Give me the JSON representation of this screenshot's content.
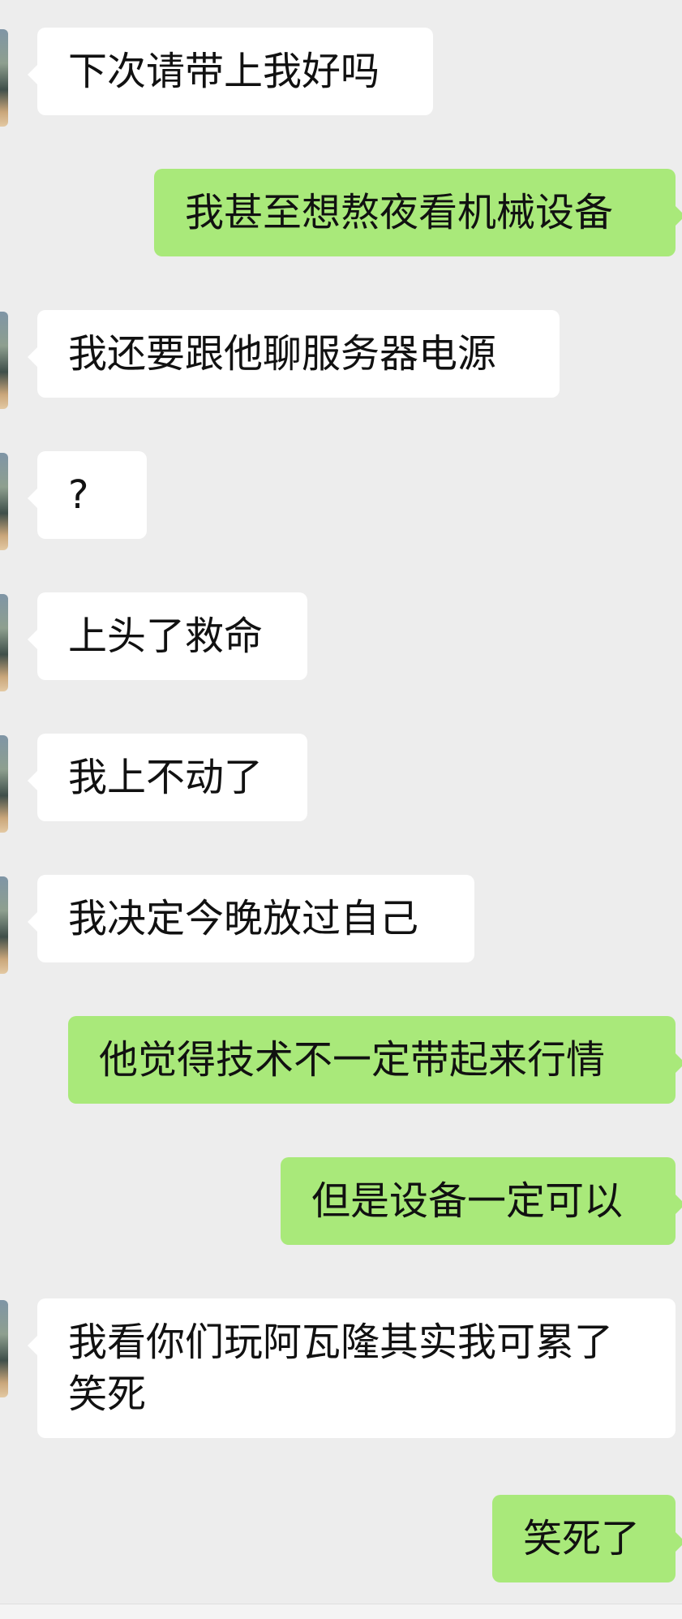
{
  "messages": [
    {
      "side": "incoming",
      "text": "下次请带上我好吗"
    },
    {
      "side": "outgoing",
      "text": "我甚至想熬夜看机械设备"
    },
    {
      "side": "incoming",
      "text": "我还要跟他聊服务器电源"
    },
    {
      "side": "incoming",
      "text": "?"
    },
    {
      "side": "incoming",
      "text": "上头了救命"
    },
    {
      "side": "incoming",
      "text": "我上不动了"
    },
    {
      "side": "incoming",
      "text": "我决定今晚放过自己"
    },
    {
      "side": "outgoing",
      "text": "他觉得技术不一定带起来行情"
    },
    {
      "side": "outgoing",
      "text": "但是设备一定可以"
    },
    {
      "side": "incoming",
      "text": "我看你们玩阿瓦隆其实我可累了笑死"
    },
    {
      "side": "outgoing",
      "text": "笑死了"
    }
  ],
  "colors": {
    "background": "#ededed",
    "incoming_bubble": "#ffffff",
    "outgoing_bubble": "#a9e97a",
    "text": "#111111"
  },
  "icons": {
    "avatar": "contact-avatar-photo"
  }
}
